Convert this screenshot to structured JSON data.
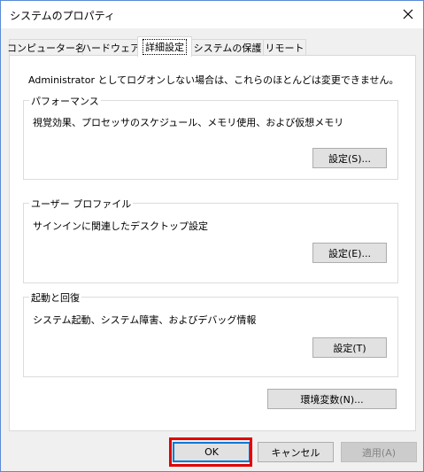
{
  "window": {
    "title": "システムのプロパティ",
    "close_label": "✕"
  },
  "tabs": [
    {
      "label": "コンピューター名"
    },
    {
      "label": "ハードウェア"
    },
    {
      "label": "詳細設定"
    },
    {
      "label": "システムの保護"
    },
    {
      "label": "リモート"
    }
  ],
  "panel": {
    "admin_note": "Administrator としてログオンしない場合は、これらのほとんどは変更できません。",
    "performance": {
      "title": "パフォーマンス",
      "description": "視覚効果、プロセッサのスケジュール、メモリ使用、および仮想メモリ",
      "button": "設定(S)..."
    },
    "user_profile": {
      "title": "ユーザー プロファイル",
      "description": "サインインに関連したデスクトップ設定",
      "button": "設定(E)..."
    },
    "startup_recovery": {
      "title": "起動と回復",
      "description": "システム起動、システム障害、およびデバッグ情報",
      "button": "設定(T)"
    },
    "env_button": "環境変数(N)..."
  },
  "footer": {
    "ok": "OK",
    "cancel": "キャンセル",
    "apply": "適用(A)"
  }
}
